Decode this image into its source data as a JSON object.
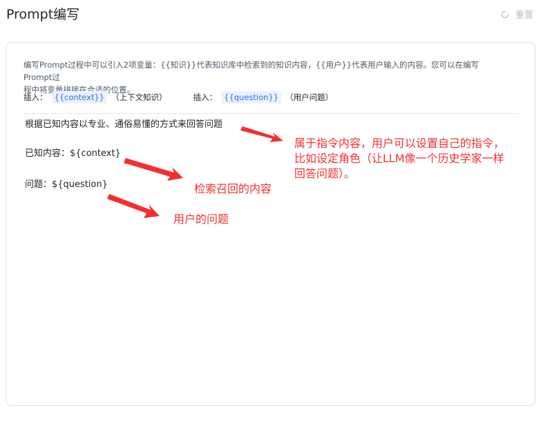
{
  "header": {
    "title": "Prompt编写",
    "reset_label": "重置",
    "reset_icon": "refresh-icon"
  },
  "card": {
    "description_line1": "编写Prompt过程中可以引入2项变量：{{知识}}代表知识库中检索到的知识内容，{{用户}}代表用户输入的内容。您可以在编写Prompt过",
    "description_line2": "程中将变量拼接在合适的位置。",
    "insert_items": [
      {
        "label": "插入：",
        "tag": "{{context}}",
        "hint": "（上下文知识）"
      },
      {
        "label": "插入：",
        "tag": "{{question}}",
        "hint": "（用户问题）"
      }
    ]
  },
  "prompt": {
    "line1": "根据已知内容以专业、通俗易懂的方式来回答问题",
    "line2": "已知内容：${context}",
    "line3": "问题：${question}"
  },
  "annotations": {
    "instruction_line1": "属于指令内容，用户可以设置自己的指令，",
    "instruction_line2": "比如设定角色（让LLM像一个历史学家一样",
    "instruction_line3": "回答问题）。",
    "context_note": "检索召回的内容",
    "question_note": "用户的问题",
    "color": "#f2302f"
  }
}
